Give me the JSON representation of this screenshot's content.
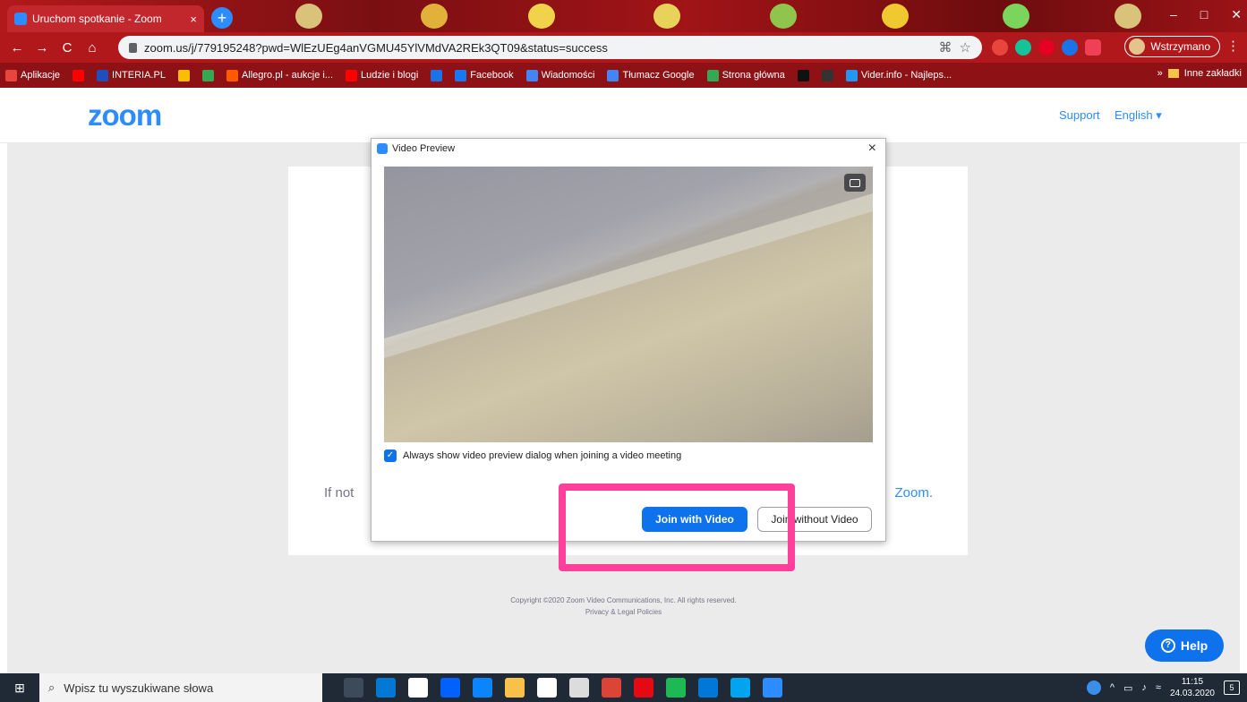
{
  "browser": {
    "tab_title": "Uruchom spotkanie - Zoom",
    "tab_close": "×",
    "new_tab": "+",
    "url": "zoom.us/j/779195248?pwd=WlEzUEg4anVGMU45YlVMdVA2REk3QT09&status=success",
    "profile_status": "Wstrzymano",
    "window_controls": [
      "‒",
      "□",
      "✕"
    ],
    "nav": {
      "back": "←",
      "forward": "→",
      "reload": "C",
      "home": "⌂"
    },
    "star": "☆",
    "menu": "⋮"
  },
  "bookmarks": {
    "items": [
      {
        "label": "Aplikacje",
        "color": "#e8453c"
      },
      {
        "label": "",
        "color": "#ff0000"
      },
      {
        "label": "INTERIA.PL",
        "color": "#1e4fbd"
      },
      {
        "label": "",
        "color": "#fbbc04"
      },
      {
        "label": "",
        "color": "#34a853"
      },
      {
        "label": "Allegro.pl - aukcje i...",
        "color": "#ff5a00"
      },
      {
        "label": "Ludzie i blogi",
        "color": "#ff0000"
      },
      {
        "label": "",
        "color": "#1a73e8"
      },
      {
        "label": "Facebook",
        "color": "#1877f2"
      },
      {
        "label": "Wiadomości",
        "color": "#4285f4"
      },
      {
        "label": "Tłumacz Google",
        "color": "#4285f4"
      },
      {
        "label": "Strona główna",
        "color": "#34a853"
      },
      {
        "label": "",
        "color": "#111111"
      },
      {
        "label": "",
        "color": "#333333"
      },
      {
        "label": "Vider.info - Najleps...",
        "color": "#2196f3"
      }
    ],
    "more": "»",
    "other": "Inne zakładki"
  },
  "zoom_page": {
    "logo": "zoom",
    "support": "Support",
    "language": "English ▾",
    "card_text_left": "If not",
    "card_text_link": "Zoom.",
    "copyright_line1": "Copyright ©2020 Zoom Video Communications, Inc. All rights reserved.",
    "copyright_line2": "Privacy & Legal Policies",
    "help_label": "Help",
    "help_icon": "?"
  },
  "dialog": {
    "title": "Video Preview",
    "close": "×",
    "checkbox_label": "Always show video preview dialog when joining a video meeting",
    "checkbox_mark": "✓",
    "join_with_video": "Join with Video",
    "join_without_video": "Join without Video"
  },
  "taskbar": {
    "start": "⊞",
    "search_icon": "⌕",
    "search_placeholder": "Wpisz tu wyszukiwane słowa",
    "apps": [
      {
        "name": "task-view",
        "color": "#3c4a5a"
      },
      {
        "name": "outlook",
        "color": "#0078d4"
      },
      {
        "name": "store",
        "color": "#ffffff"
      },
      {
        "name": "dropbox",
        "color": "#0061ff"
      },
      {
        "name": "mail",
        "color": "#0a84ff"
      },
      {
        "name": "explorer",
        "color": "#f8c24a"
      },
      {
        "name": "amazon",
        "color": "#ffffff"
      },
      {
        "name": "document",
        "color": "#dcdcdc"
      },
      {
        "name": "chrome",
        "color": "#db4437"
      },
      {
        "name": "netflix",
        "color": "#e50914"
      },
      {
        "name": "spotify",
        "color": "#1db954"
      },
      {
        "name": "edge",
        "color": "#0078d7"
      },
      {
        "name": "photos",
        "color": "#00a4ef"
      },
      {
        "name": "zoom",
        "color": "#2d8cff"
      }
    ],
    "tray_arrow": "^",
    "time": "11:15",
    "date": "24.03.2020",
    "notifications": "5"
  }
}
